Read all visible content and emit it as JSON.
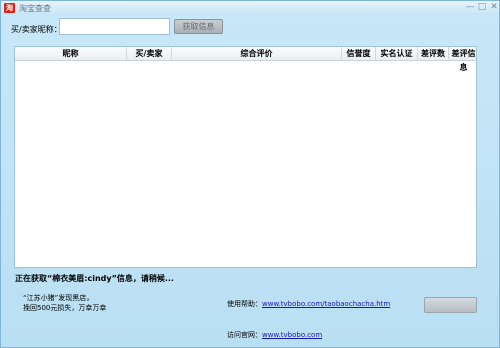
{
  "window": {
    "title": "淘宝查查",
    "icon_text": "淘",
    "min_symbol": "—",
    "max_symbol": "□",
    "close_symbol": "✕"
  },
  "search": {
    "label": "买/卖家昵称：",
    "value": "",
    "placeholder": "",
    "button_label": "获取信息"
  },
  "table": {
    "columns": [
      "昵称",
      "买/卖家",
      "综合评价",
      "信誉度",
      "实名认证",
      "差评数",
      "差评信息"
    ],
    "rows": []
  },
  "status": {
    "text": "正在获取“棉衣美眉:cindy”信息，请稍候..."
  },
  "footer": {
    "news_line1": "“江苏小猪”发现黑店，",
    "news_line2": "挽回500元损失，万幸万幸",
    "help_label": "使用帮助：",
    "help_link": "www.tvbobo.com/taobaochacha.htm",
    "site_label": "访问官网：",
    "site_link": "www.tvbobo.com"
  }
}
